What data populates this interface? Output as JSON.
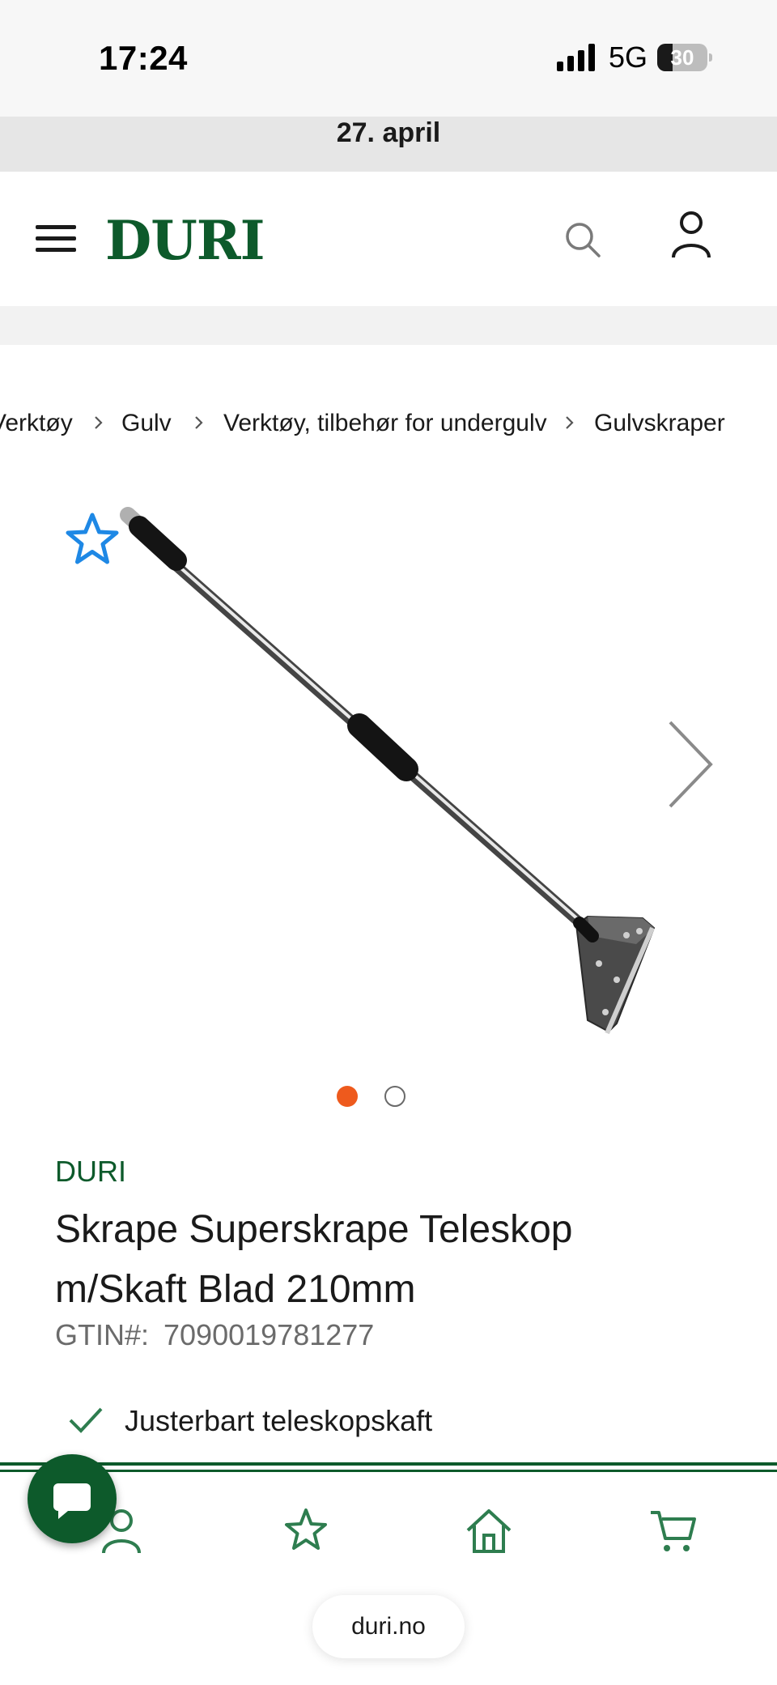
{
  "status_bar": {
    "time": "17:24",
    "network": "5G",
    "battery_percent": "30",
    "battery_level": 0.3
  },
  "announcement": {
    "text": "27. april"
  },
  "header": {
    "logo": "DURI",
    "icons": [
      "menu-icon",
      "search-icon",
      "user-icon"
    ]
  },
  "breadcrumb": {
    "items": [
      "Verktøy",
      "Gulv",
      "Verktøy, tilbehør for undergulv",
      "Gulvskraper"
    ],
    "separator_icon": "chevron-right-icon"
  },
  "gallery": {
    "image_icon": "floor-scraper-product-image",
    "image_count": 2,
    "active_index": 0,
    "next_icon": "chevron-right-icon",
    "favorite_icon": "star-outline-icon"
  },
  "product": {
    "brand": "DURI",
    "title": "Skrape Superskrape Teleskop m/Skaft Blad 210mm",
    "gtin_label": "GTIN#:",
    "gtin_value": "7090019781277",
    "features": [
      "Justerbart teleskopskaft"
    ]
  },
  "bottom_nav": {
    "items": [
      "user-icon",
      "star-icon",
      "home-icon",
      "cart-icon"
    ],
    "chat_icon": "chat-bubble-icon"
  },
  "browser": {
    "url": "duri.no"
  },
  "colors": {
    "brand_green": "#0d5a2b",
    "accent_orange": "#ee5a1d",
    "favorite_blue": "#1e88e5"
  }
}
